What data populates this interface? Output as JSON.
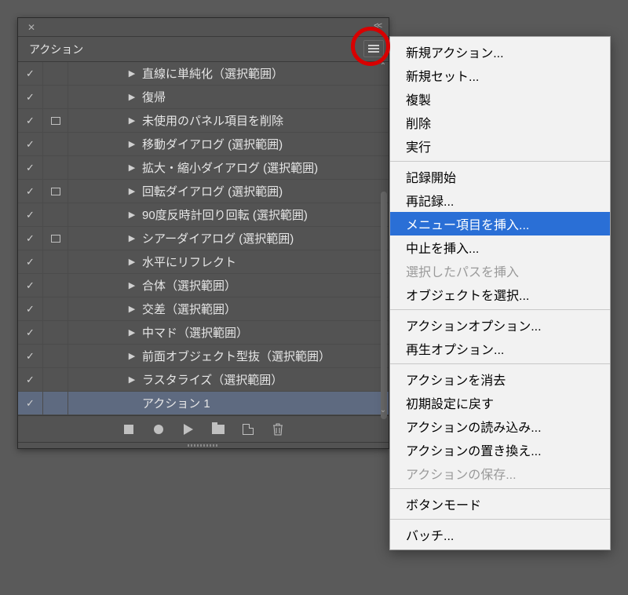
{
  "panel": {
    "tab_title": "アクション",
    "rows": [
      {
        "checked": true,
        "dialog": false,
        "label": "直線に単純化（選択範囲）"
      },
      {
        "checked": true,
        "dialog": false,
        "label": "復帰"
      },
      {
        "checked": true,
        "dialog": true,
        "label": "未使用のパネル項目を削除"
      },
      {
        "checked": true,
        "dialog": false,
        "label": "移動ダイアログ (選択範囲)"
      },
      {
        "checked": true,
        "dialog": false,
        "label": "拡大・縮小ダイアログ (選択範囲)"
      },
      {
        "checked": true,
        "dialog": true,
        "label": "回転ダイアログ (選択範囲)"
      },
      {
        "checked": true,
        "dialog": false,
        "label": "90度反時計回り回転 (選択範囲)"
      },
      {
        "checked": true,
        "dialog": true,
        "label": "シアーダイアログ (選択範囲)"
      },
      {
        "checked": true,
        "dialog": false,
        "label": "水平にリフレクト"
      },
      {
        "checked": true,
        "dialog": false,
        "label": "合体（選択範囲）"
      },
      {
        "checked": true,
        "dialog": false,
        "label": "交差（選択範囲）"
      },
      {
        "checked": true,
        "dialog": false,
        "label": "中マド（選択範囲）"
      },
      {
        "checked": true,
        "dialog": false,
        "label": "前面オブジェクト型抜（選択範囲）"
      },
      {
        "checked": true,
        "dialog": false,
        "label": "ラスタライズ（選択範囲）"
      }
    ],
    "selected_row_label": "アクション 1"
  },
  "menu": {
    "groups": [
      [
        {
          "label": "新規アクション...",
          "disabled": false
        },
        {
          "label": "新規セット...",
          "disabled": false
        },
        {
          "label": "複製",
          "disabled": false
        },
        {
          "label": "削除",
          "disabled": false
        },
        {
          "label": "実行",
          "disabled": false
        }
      ],
      [
        {
          "label": "記録開始",
          "disabled": false
        },
        {
          "label": "再記録...",
          "disabled": false
        },
        {
          "label": "メニュー項目を挿入...",
          "disabled": false,
          "highlighted": true
        },
        {
          "label": "中止を挿入...",
          "disabled": false
        },
        {
          "label": "選択したパスを挿入",
          "disabled": true
        },
        {
          "label": "オブジェクトを選択...",
          "disabled": false
        }
      ],
      [
        {
          "label": "アクションオプション...",
          "disabled": false
        },
        {
          "label": "再生オプション...",
          "disabled": false
        }
      ],
      [
        {
          "label": "アクションを消去",
          "disabled": false
        },
        {
          "label": "初期設定に戻す",
          "disabled": false
        },
        {
          "label": "アクションの読み込み...",
          "disabled": false
        },
        {
          "label": "アクションの置き換え...",
          "disabled": false
        },
        {
          "label": "アクションの保存...",
          "disabled": true
        }
      ],
      [
        {
          "label": "ボタンモード",
          "disabled": false
        }
      ],
      [
        {
          "label": "バッチ...",
          "disabled": false
        }
      ]
    ]
  }
}
